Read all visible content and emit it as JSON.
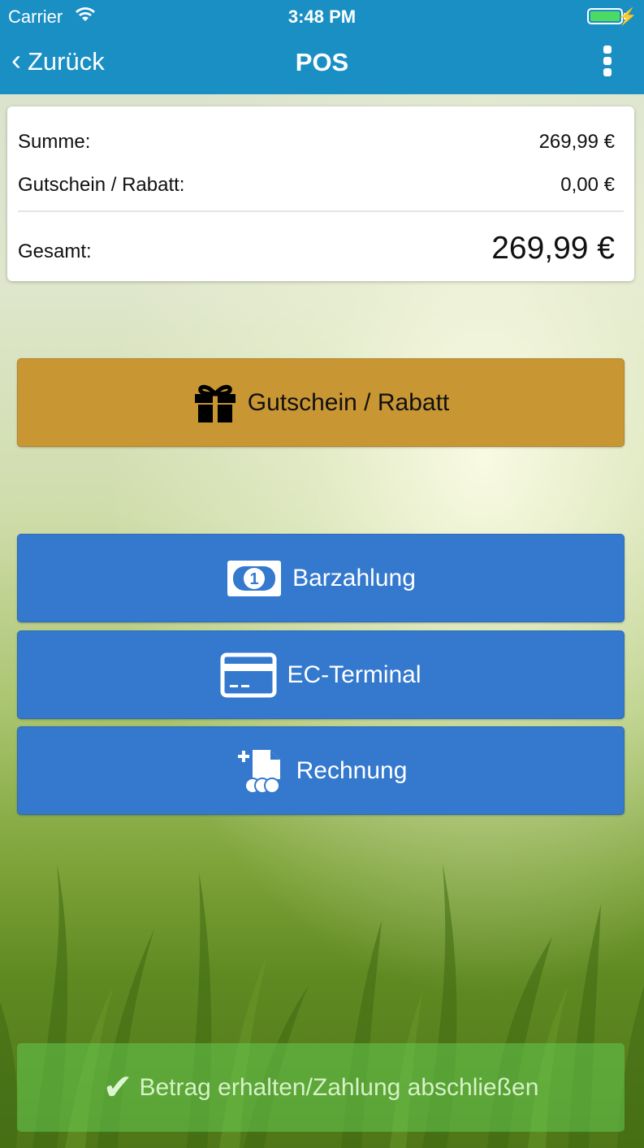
{
  "statusbar": {
    "carrier": "Carrier",
    "time": "3:48 PM"
  },
  "navbar": {
    "back_label": "Zurück",
    "title": "POS",
    "menu_icon": "more-vertical-icon"
  },
  "summary": {
    "sum_label": "Summe:",
    "sum_value": "269,99 €",
    "voucher_label": "Gutschein / Rabatt:",
    "voucher_value": "0,00 €",
    "total_label": "Gesamt:",
    "total_value": "269,99 €"
  },
  "actions": {
    "voucher_button": "Gutschein / Rabatt",
    "cash_button": "Barzahlung",
    "ec_button": "EC-Terminal",
    "invoice_button": "Rechnung",
    "finish_button": "Betrag erhalten/Zahlung abschließen"
  },
  "colors": {
    "header": "#1a8fc4",
    "voucher": "#c89633",
    "payment": "#3479cd",
    "finish": "#64c850"
  }
}
